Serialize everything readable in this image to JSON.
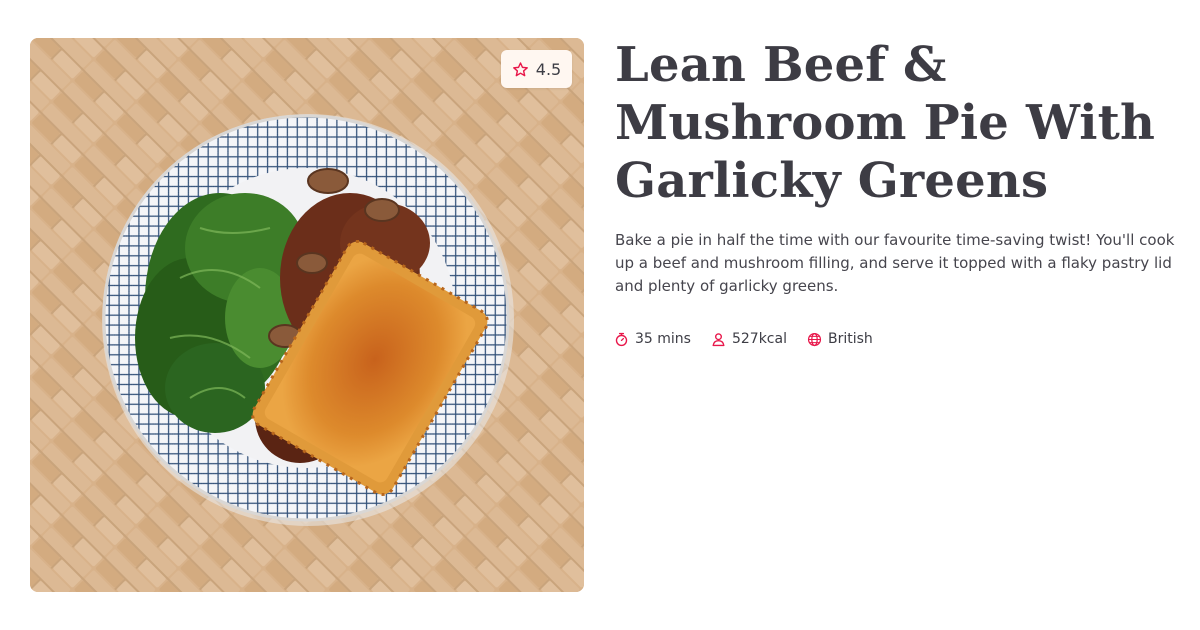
{
  "recipe": {
    "title": "Lean Beef & Mushroom Pie With Garlicky Greens",
    "description": "Bake a pie in half the time with our favourite time-saving twist! You'll cook up a beef and mushroom filling, and serve it topped with a flaky pastry lid and plenty of garlicky greens.",
    "rating": "4.5",
    "image_alt": "Lean Beef & Mushroom Pie With Garlicky Greens",
    "meta": {
      "time": "35 mins",
      "calories": "527kcal",
      "cuisine": "British"
    }
  },
  "icons": {
    "rating": "star-outline-icon",
    "time": "stopwatch-icon",
    "calories": "person-icon",
    "cuisine": "globe-icon"
  },
  "colors": {
    "accent": "#e8174a",
    "title": "#3d3c44",
    "text": "#46454d",
    "badge_bg": "#fff7f1"
  }
}
